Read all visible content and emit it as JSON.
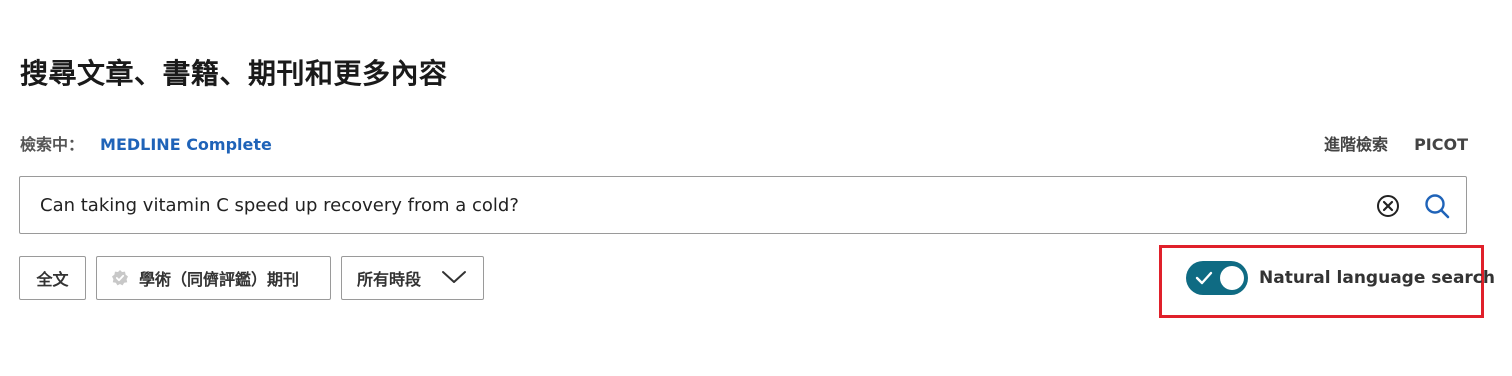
{
  "page": {
    "title": "搜尋文章、書籍、期刊和更多內容"
  },
  "searching": {
    "label": "檢索中：",
    "database": "MEDLINE Complete"
  },
  "top_links": {
    "advanced": "進階檢索",
    "picot": "PICOT"
  },
  "search": {
    "value": "Can taking vitamin C speed up recovery from a cold?",
    "clear_icon": "circle-x-icon",
    "search_icon": "magnifier-icon"
  },
  "filters": {
    "full_text": "全文",
    "peer_reviewed": "學術（同儕評鑑）期刊",
    "peer_icon": "badge-check-icon",
    "time_range": "所有時段",
    "time_icon": "chevron-down-icon"
  },
  "natural_language": {
    "label": "Natural language search",
    "enabled": true,
    "toggle_color": "#0f6b83"
  },
  "colors": {
    "link": "#1f63b8",
    "highlight": "#e0202a"
  }
}
